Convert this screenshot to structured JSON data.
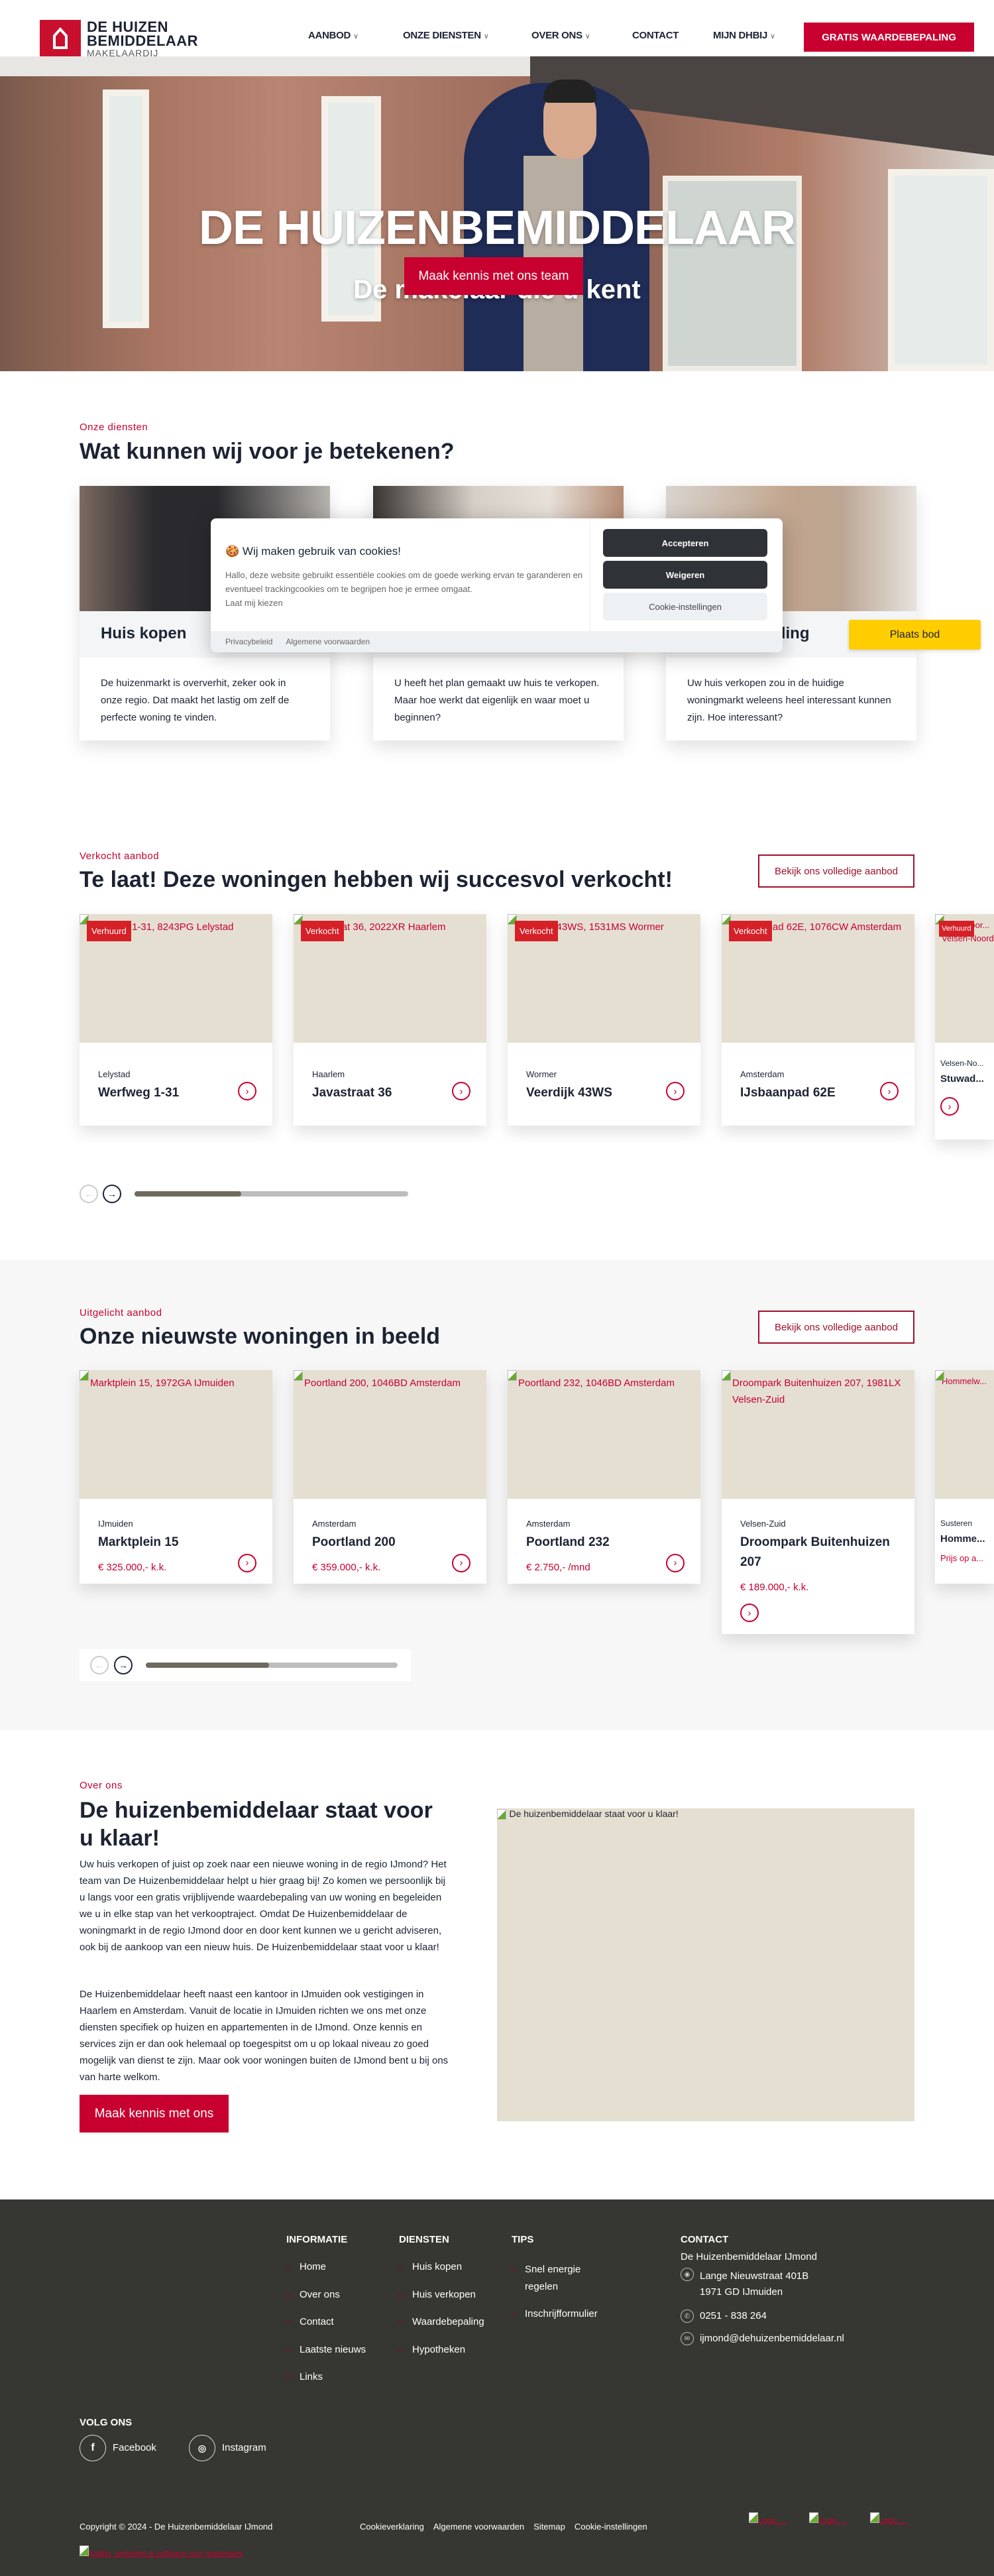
{
  "header": {
    "logo": {
      "line1": "DE HUIZEN",
      "line2": "BEMIDDELAAR",
      "line3": "MAKELAARDIJ"
    },
    "nav": [
      {
        "label": "AANBOD",
        "dropdown": true
      },
      {
        "label": "ONZE DIENSTEN",
        "dropdown": true
      },
      {
        "label": "OVER ONS",
        "dropdown": true
      },
      {
        "label": "CONTACT",
        "dropdown": false
      },
      {
        "label": "MIJN DHBIJ",
        "dropdown": true
      }
    ],
    "cta": "GRATIS WAARDEBEPALING"
  },
  "hero": {
    "title": "DE HUIZENBEMIDDELAAR",
    "subtitle": "De makelaar die u kent",
    "button": "Maak kennis met ons team"
  },
  "services": {
    "kicker": "Onze diensten",
    "heading": "Wat kunnen wij voor je betekenen?",
    "cards": [
      {
        "title": "Huis kopen",
        "text": "De huizenmarkt is oververhit, zeker ook in onze regio. Dat maakt het lastig om zelf de perfecte woning te vinden."
      },
      {
        "title": "",
        "text": "U heeft het plan gemaakt uw huis te verkopen. Maar hoe werkt dat eigenlijk en waar moet u beginnen?"
      },
      {
        "title": "Waardebepaling",
        "text": "Uw huis verkopen zou in de huidige woningmarkt weleens heel interessant kunnen zijn. Hoe interessant?"
      }
    ]
  },
  "cookie": {
    "title": "Wij maken gebruik van cookies!",
    "body": "Hallo, deze website gebruikt essentiële cookies om de goede werking ervan te garanderen en eventueel trackingcookies om te begrijpen hoe je ermee omgaat.",
    "choose_link": "Laat mij kiezen",
    "accept": "Accepteren",
    "decline": "Weigeren",
    "settings": "Cookie-instellingen",
    "footer_links": [
      "Privacybeleid",
      "Algemene voorwaarden"
    ]
  },
  "plaats_bod": "Plaats bod",
  "sold": {
    "kicker": "Verkocht aanbod",
    "heading": "Te laat! Deze woningen hebben wij succesvol verkocht!",
    "button": "Bekijk ons volledige aanbod",
    "progress": 0.39,
    "items": [
      {
        "alt": "Werfweg 1-31, 8243PG Lelystad",
        "badge": "Verhuurd",
        "city": "Lelystad",
        "street": "Werfweg 1-31"
      },
      {
        "alt": "Javastraat 36, 2022XR Haarlem",
        "badge": "Verkocht",
        "city": "Haarlem",
        "street": "Javastraat 36"
      },
      {
        "alt": "Veerdijk 43WS, 1531MS Wormer",
        "badge": "Verkocht",
        "city": "Wormer",
        "street": "Veerdijk 43WS"
      },
      {
        "alt": "IJsbaanpad 62E, 1076CW Amsterdam",
        "badge": "Verkocht",
        "city": "Amsterdam",
        "street": "IJsbaanpad 62E"
      },
      {
        "alt": "Stuwadoor... Velsen-Noord",
        "badge": "Verhuurd",
        "city": "Velsen-No...",
        "street": "Stuwad..."
      }
    ]
  },
  "featured": {
    "kicker": "Uitgelicht aanbod",
    "heading": "Onze nieuwste woningen in beeld",
    "button": "Bekijk ons volledige aanbod",
    "progress": 0.49,
    "items": [
      {
        "alt": "Marktplein 15, 1972GA IJmuiden",
        "city": "IJmuiden",
        "street": "Marktplein 15",
        "price": "€ 325.000,- k.k."
      },
      {
        "alt": "Poortland 200, 1046BD Amsterdam",
        "city": "Amsterdam",
        "street": "Poortland 200",
        "price": "€ 359.000,- k.k."
      },
      {
        "alt": "Poortland 232, 1046BD Amsterdam",
        "city": "Amsterdam",
        "street": "Poortland 232",
        "price": "€ 2.750,- /mnd"
      },
      {
        "alt": "Droompark Buitenhuizen 207, 1981LX Velsen-Zuid",
        "city": "Velsen-Zuid",
        "street": "Droompark Buitenhuizen 207",
        "price": "€ 189.000,- k.k."
      },
      {
        "alt": "Hommelw...",
        "city": "Susteren",
        "street": "Homme...",
        "price": "Prijs op a..."
      }
    ]
  },
  "about": {
    "kicker": "Over ons",
    "heading": "De huizenbemiddelaar staat voor u klaar!",
    "p1": "Uw huis verkopen of juist op zoek naar een nieuwe woning in de regio IJmond? Het team van De Huizenbemiddelaar helpt u hier graag bij! Zo komen we persoonlijk bij u langs voor een gratis vrijblijvende waardebepaling van uw woning en begeleiden we u in elke stap van het verkooptraject. Omdat De Huizenbemiddelaar de woningmarkt in de regio IJmond door en door kent kunnen we u gericht adviseren, ook bij de aankoop van een nieuw huis. De Huizenbemiddelaar staat voor u klaar!",
    "p2": "De Huizenbemiddelaar heeft naast een kantoor in IJmuiden ook vestigingen in Haarlem en Amsterdam. Vanuit de locatie in IJmuiden richten we ons met onze diensten specifiek op huizen en appartementen in de IJmond. Onze kennis en services zijn er dan ook helemaal op toegespitst om u op lokaal niveau zo goed mogelijk van dienst te zijn. Maar ook voor woningen buiten de IJmond bent u bij ons van harte welkom.",
    "button": "Maak kennis met ons",
    "image_alt": "De huizenbemiddelaar staat voor u klaar!"
  },
  "footer": {
    "columns": [
      {
        "heading": "INFORMATIE",
        "links": [
          "Home",
          "Over ons",
          "Contact",
          "Laatste nieuws",
          "Links"
        ]
      },
      {
        "heading": "DIENSTEN",
        "links": [
          "Huis kopen",
          "Huis verkopen",
          "Waardebepaling",
          "Hypotheken"
        ]
      },
      {
        "heading": "TIPS",
        "links": [
          "Snel energie regelen",
          "Inschrijfformulier"
        ]
      }
    ],
    "contact": {
      "heading": "CONTACT",
      "name": "De Huizenbemiddelaar IJmond",
      "street": "Lange Nieuwstraat 401B",
      "city": "1971 GD IJmuiden",
      "phone": "0251 - 838 264",
      "email": "ijmond@dehuizenbemiddelaar.nl"
    },
    "follow": {
      "heading": "VOLG ONS",
      "facebook": "Facebook",
      "instagram": "Instagram"
    },
    "copyright": "Copyright © 2024 - De Huizenbemiddelaar IJmond",
    "legal": [
      "Cookieverklaring",
      "Algemene voorwaarden",
      "Sitemap",
      "Cookie-instellingen"
    ],
    "logos": [
      "Logo: ...",
      "Logo: ...",
      "Logo: ..."
    ],
    "kolibri": "Kolibri, websites & software voor makelaars"
  }
}
